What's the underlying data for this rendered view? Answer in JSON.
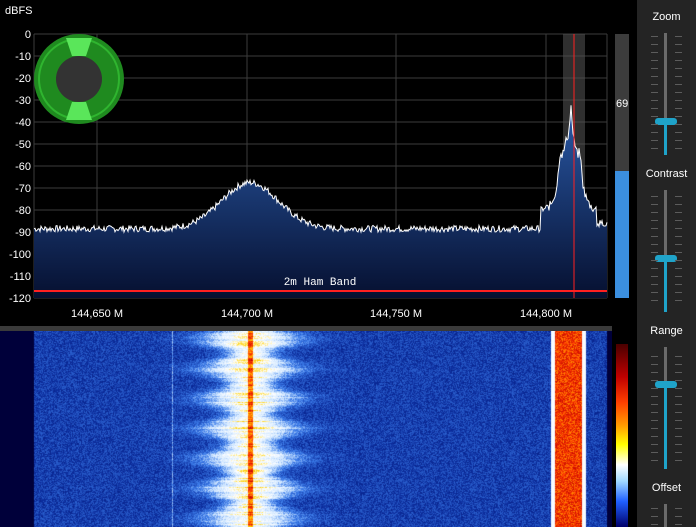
{
  "spectrum": {
    "y_axis_label": "dBFS",
    "y_ticks": [
      "0",
      "-10",
      "-20",
      "-30",
      "-40",
      "-50",
      "-60",
      "-70",
      "-80",
      "-90",
      "-100",
      "-110",
      "-120"
    ],
    "x_ticks": [
      "144,650 M",
      "144,700 M",
      "144,750 M",
      "144,800 M"
    ],
    "band_label": "2m Ham Band",
    "colors": {
      "trace": "#ffffff",
      "fill_top": "#2a5aa8",
      "fill_bottom": "#061030",
      "band_marker": "#ff2020",
      "grid": "#3c3c3c",
      "filter": "#555555"
    }
  },
  "level_meter": {
    "value": "69",
    "fraction": 0.69
  },
  "side_panel": {
    "zoom": {
      "label": "Zoom",
      "fraction": 0.4
    },
    "contrast": {
      "label": "Contrast",
      "fraction": 0.55
    },
    "range": {
      "label": "Range",
      "fraction": 0.5
    },
    "offset": {
      "label": "Offset"
    }
  },
  "waterfall": {
    "colors": [
      "#00003a",
      "#0a2a9a",
      "#3a7ae8",
      "#cfe6ff",
      "#ffffff",
      "#ffd000",
      "#ff4000",
      "#c00000"
    ]
  }
}
